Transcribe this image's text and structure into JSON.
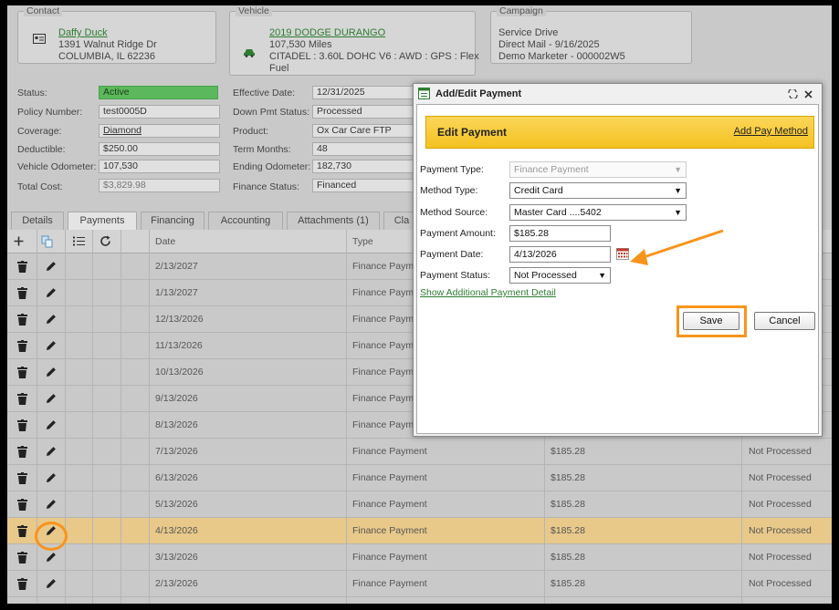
{
  "contact": {
    "section_title": "Contact",
    "name": "Daffy Duck",
    "address1": "1391 Walnut Ridge Dr",
    "address2": "COLUMBIA, IL 62236"
  },
  "vehicle": {
    "section_title": "Vehicle",
    "name": "2019 DODGE DURANGO",
    "miles": "107,530 Miles",
    "spec": "CITADEL : 3.60L DOHC V6 : AWD : GPS : Flex",
    "spec2": "Fuel"
  },
  "campaign": {
    "section_title": "Campaign",
    "line1": "Service Drive",
    "line2": "Direct Mail - 9/16/2025",
    "line3": "Demo Marketer - 000002W5"
  },
  "policy": {
    "status_label": "Status:",
    "status_value": "Active",
    "policy_number_label": "Policy Number:",
    "policy_number_value": "test0005D",
    "coverage_label": "Coverage:",
    "coverage_value": "Diamond",
    "deductible_label": "Deductible:",
    "deductible_value": "$250.00",
    "odometer_label": "Vehicle Odometer:",
    "odometer_value": "107,530",
    "total_cost_label": "Total Cost:",
    "total_cost_value": "$3,829.98",
    "effective_date_label": "Effective Date:",
    "effective_date_value": "12/31/2025",
    "down_pmt_label": "Down Pmt Status:",
    "down_pmt_value": "Processed",
    "product_label": "Product:",
    "product_value": "Ox Car Care FTP",
    "term_months_label": "Term Months:",
    "term_months_value": "48",
    "ending_odometer_label": "Ending Odometer:",
    "ending_odometer_value": "182,730",
    "finance_status_label": "Finance Status:",
    "finance_status_value": "Financed"
  },
  "tabs": [
    "Details",
    "Payments",
    "Financing",
    "Accounting",
    "Attachments (1)",
    "Cla"
  ],
  "grid": {
    "col_date": "Date",
    "col_type": "Type",
    "rows": [
      {
        "date": "2/13/2027",
        "type": "Finance Payment",
        "amount": "",
        "status": ""
      },
      {
        "date": "1/13/2027",
        "type": "Finance Payment",
        "amount": "",
        "status": ""
      },
      {
        "date": "12/13/2026",
        "type": "Finance Payment",
        "amount": "",
        "status": ""
      },
      {
        "date": "11/13/2026",
        "type": "Finance Payment",
        "amount": "",
        "status": ""
      },
      {
        "date": "10/13/2026",
        "type": "Finance Payment",
        "amount": "",
        "status": ""
      },
      {
        "date": "9/13/2026",
        "type": "Finance Payment",
        "amount": "",
        "status": ""
      },
      {
        "date": "8/13/2026",
        "type": "Finance Payment",
        "amount": "",
        "status": ""
      },
      {
        "date": "7/13/2026",
        "type": "Finance Payment",
        "amount": "$185.28",
        "status": "Not Processed"
      },
      {
        "date": "6/13/2026",
        "type": "Finance Payment",
        "amount": "$185.28",
        "status": "Not Processed"
      },
      {
        "date": "5/13/2026",
        "type": "Finance Payment",
        "amount": "$185.28",
        "status": "Not Processed"
      },
      {
        "date": "4/13/2026",
        "type": "Finance Payment",
        "amount": "$185.28",
        "status": "Not Processed"
      },
      {
        "date": "3/13/2026",
        "type": "Finance Payment",
        "amount": "$185.28",
        "status": "Not Processed"
      },
      {
        "date": "2/13/2026",
        "type": "Finance Payment",
        "amount": "$185.28",
        "status": "Not Processed"
      }
    ]
  },
  "dialog": {
    "title": "Add/Edit Payment",
    "banner_title": "Edit Payment",
    "add_pay_method": "Add Pay Method",
    "payment_type_label": "Payment Type:",
    "payment_type_value": "Finance Payment",
    "method_type_label": "Method Type:",
    "method_type_value": "Credit Card",
    "method_source_label": "Method Source:",
    "method_source_value": "Master Card ....5402",
    "payment_amount_label": "Payment Amount:",
    "payment_amount_value": "$185.28",
    "payment_date_label": "Payment Date:",
    "payment_date_value": "4/13/2026",
    "payment_status_label": "Payment Status:",
    "payment_status_value": "Not Processed",
    "show_additional": "Show Additional Payment Detail",
    "save_label": "Save",
    "cancel_label": "Cancel"
  },
  "colors": {
    "accent": "#f7941d",
    "active_status": "#5cb85c",
    "link": "#2e7d32",
    "banner": "#f4c220",
    "selected_row": "#e8c98a"
  }
}
